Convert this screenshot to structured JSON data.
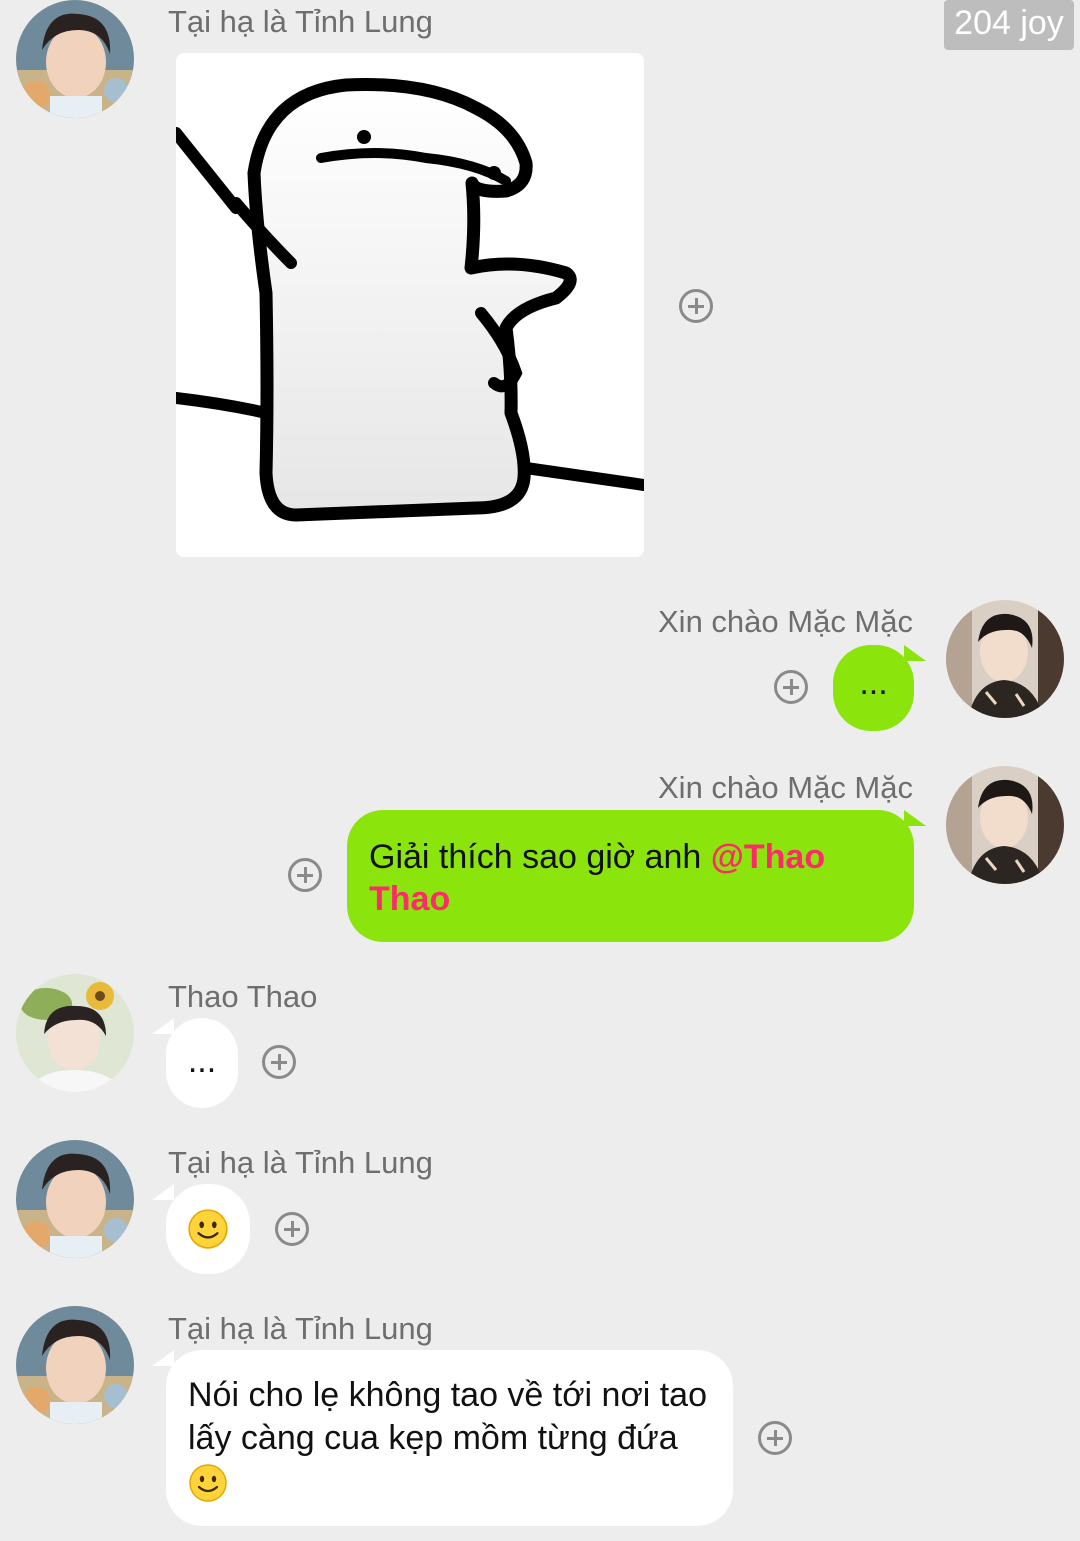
{
  "badge": {
    "text": "204 joy"
  },
  "users": {
    "tinh_lung": "Tại hạ là Tỉnh Lung",
    "mac_mac": "Xin chào Mặc Mặc",
    "thao_thao": "Thao Thao"
  },
  "messages": {
    "m2": {
      "text": "..."
    },
    "m3": {
      "text": "Giải thích sao giờ anh ",
      "mention": "@Thao Thao"
    },
    "m4": {
      "text": "..."
    },
    "m6": {
      "text": "Nói cho lẹ không tao về tới nơi tao lấy càng cua kẹp mồm từng đứa "
    }
  },
  "icons": {
    "add_reaction": "plus-circle-icon",
    "emoji": "smile-emoji-icon"
  },
  "colors": {
    "background": "#ededed",
    "own_bubble": "#8be40b",
    "other_bubble": "#ffffff",
    "mention": "#ff2a6a"
  }
}
